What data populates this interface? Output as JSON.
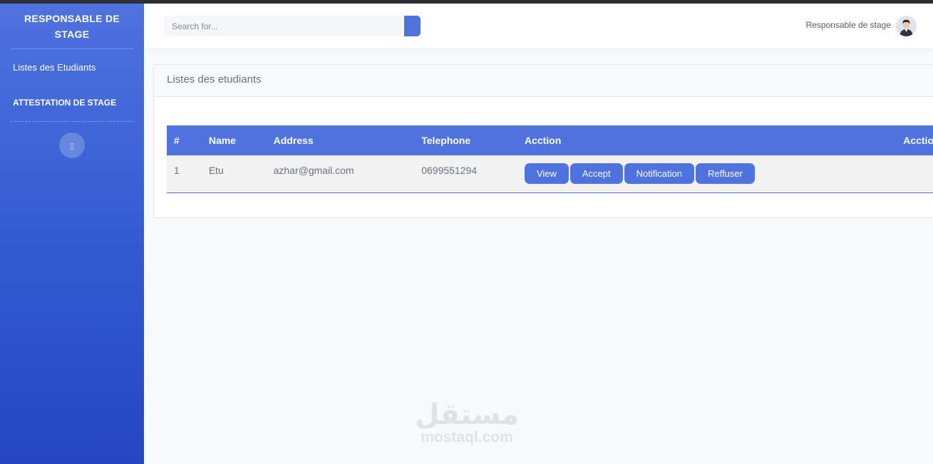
{
  "sidebar": {
    "brand_line1": "RESPONSABLE DE",
    "brand_line2": "STAGE",
    "nav_item": "Listes des Etudiants",
    "section": "ATTESTATION DE STAGE",
    "toggle_icon": "sidebar-toggle-icon"
  },
  "header": {
    "search_placeholder": "Search for...",
    "search_icon": "search-icon",
    "user_name": "Responsable de stage",
    "avatar_icon": "user-avatar"
  },
  "card": {
    "title": "Listes des etudiants"
  },
  "table": {
    "headers": [
      "#",
      "Name",
      "Address",
      "Telephone",
      "Acction",
      "Acctio"
    ],
    "rows": [
      {
        "num": "1",
        "name": "Etu",
        "address": "azhar@gmail.com",
        "telephone": "0699551294"
      }
    ],
    "actions": [
      "View",
      "Accept",
      "Notification",
      "Reffuser"
    ]
  },
  "watermark": {
    "arabic": "مستقل",
    "latin": "mostaql.com"
  },
  "colors": {
    "accent": "#4e73df",
    "topbar": "#2d2f34",
    "background": "#f8f9fc"
  }
}
